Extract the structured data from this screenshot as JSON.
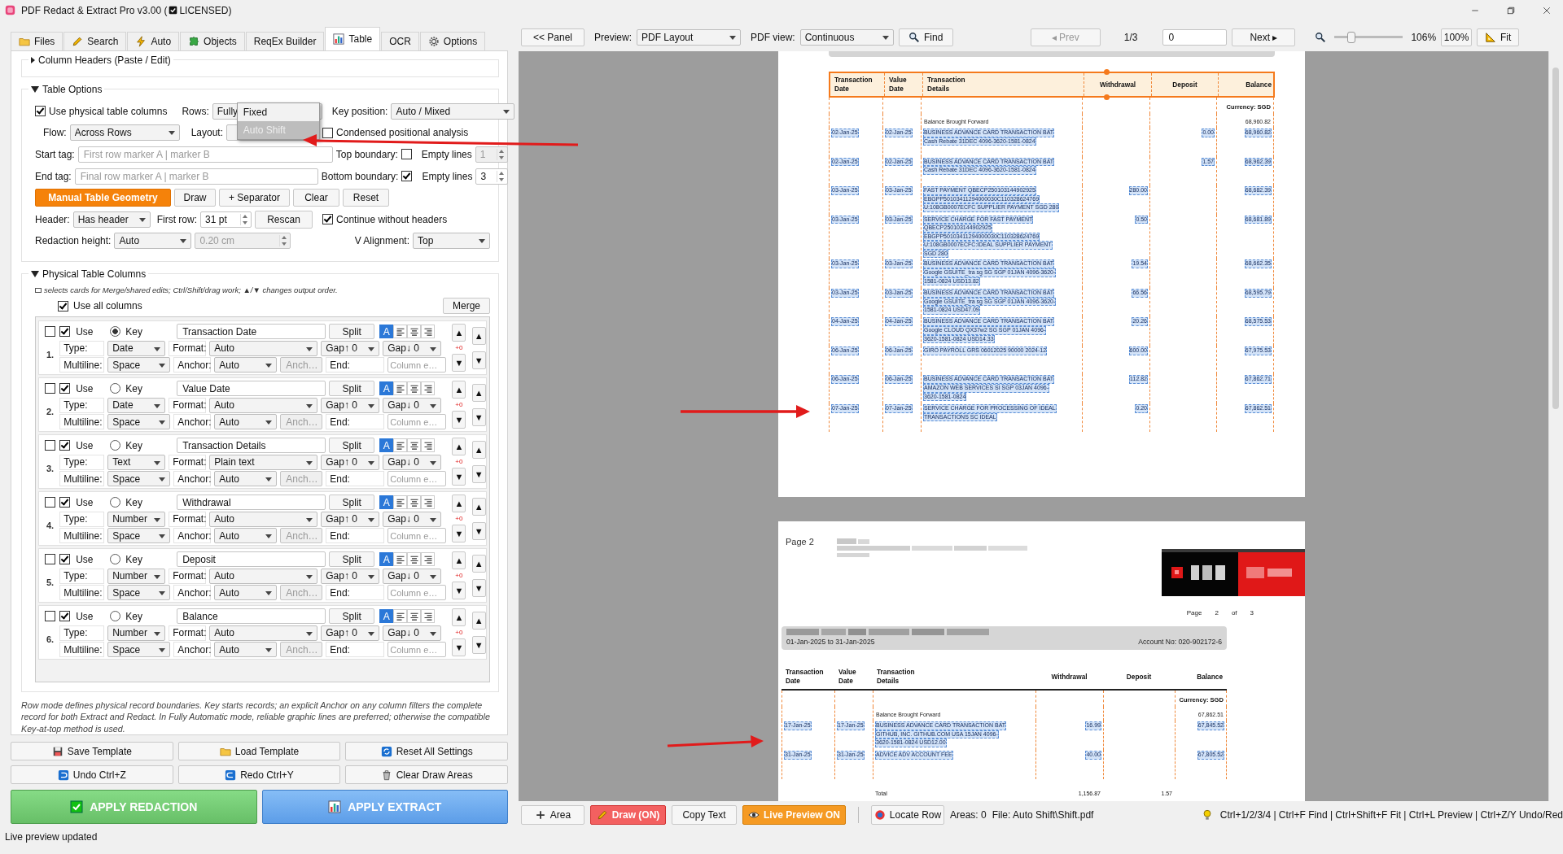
{
  "window": {
    "title_prefix": "PDF Redact & Extract Pro v3.00 (",
    "licensed": true,
    "title_suffix": "LICENSED)"
  },
  "tabs": [
    {
      "label": "Files",
      "selected": false
    },
    {
      "label": "Search",
      "selected": false
    },
    {
      "label": "Auto",
      "selected": false
    },
    {
      "label": "Objects",
      "selected": false
    },
    {
      "label": "ReqEx Builder",
      "selected": false
    },
    {
      "label": "Table",
      "selected": true
    },
    {
      "label": "OCR",
      "selected": false
    },
    {
      "label": "Options",
      "selected": false
    }
  ],
  "column_headers": {
    "title": "Column Headers (Paste / Edit)",
    "expanded": false
  },
  "table_options": {
    "title": "Table Options",
    "expanded": true,
    "use_physical": {
      "label": "Use physical table columns",
      "checked": true
    },
    "rows": {
      "label": "Rows:",
      "value": "Fully"
    },
    "rows_menu": [
      {
        "label": "Fixed",
        "selected": false
      },
      {
        "label": "Auto Shift",
        "selected": true
      }
    ],
    "key_position": {
      "label": "Key position:",
      "value": "Auto / Mixed"
    },
    "flow": {
      "label": "Flow:",
      "value": "Across Rows"
    },
    "layout": {
      "label": "Layout:"
    },
    "condensed": {
      "label": "Condensed positional analysis",
      "checked": false
    },
    "start_tag": {
      "label": "Start tag:",
      "placeholder": "First row marker A | marker B"
    },
    "top_boundary": {
      "label": "Top boundary:",
      "checked": false
    },
    "top_empty": {
      "label": "Empty lines",
      "value": "1",
      "disabled": true
    },
    "end_tag": {
      "label": "End tag:",
      "placeholder": "Final row marker A | marker B"
    },
    "bottom_boundary": {
      "label": "Bottom boundary:",
      "checked": true
    },
    "bottom_empty": {
      "label": "Empty lines",
      "value": "3",
      "disabled": false
    },
    "buttons": [
      {
        "label": "Manual Table Geometry",
        "kind": "primary"
      },
      {
        "label": "Draw",
        "kind": "plain"
      },
      {
        "label": "+ Separator",
        "kind": "plain"
      },
      {
        "label": "Clear",
        "kind": "plain"
      },
      {
        "label": "Reset",
        "kind": "plain"
      }
    ],
    "header": {
      "label": "Header:",
      "value": "Has header"
    },
    "first_row": {
      "label": "First row:",
      "value": "31 pt"
    },
    "rescan": "Rescan",
    "continue_without_headers": {
      "label": "Continue without headers",
      "checked": true
    },
    "redaction_height": {
      "label": "Redaction height:",
      "value": "Auto"
    },
    "height_value": {
      "value": "0.20 cm",
      "disabled": true
    },
    "v_alignment": {
      "label": "V Alignment:",
      "value": "Top"
    }
  },
  "physical_columns": {
    "title": "Physical Table Columns",
    "expanded": true,
    "hint": "selects cards for Merge/shared edits; Ctrl/Shift/drag work; ▲/▼ changes output order.",
    "use_all": {
      "label": "Use all columns",
      "checked": true
    },
    "merge": "Merge",
    "cards": [
      {
        "number": "1.",
        "selected": false,
        "use": {
          "label": "Use",
          "checked": true
        },
        "key": {
          "label": "Key",
          "selected": true
        },
        "name": "Transaction Date",
        "split": "Split",
        "align": [
          {
            "kind": "auto",
            "label": "A",
            "selected": true
          },
          {
            "kind": "left",
            "selected": false
          },
          {
            "kind": "center",
            "selected": false
          },
          {
            "kind": "right",
            "selected": false
          }
        ],
        "type": {
          "label": "Type:",
          "value": "Date"
        },
        "format": {
          "label": "Format:",
          "value": "Auto"
        },
        "gap_up": "Gap↑ 0",
        "gap_down": "Gap↓ 0",
        "offset": "+0",
        "multiline": {
          "label": "Multiline:",
          "value": "Space"
        },
        "anchor": {
          "label": "Anchor:",
          "value": "Auto"
        },
        "anchor_text": {
          "placeholder": "Anch…"
        },
        "end": {
          "label": "End:",
          "placeholder": "Column e…"
        },
        "move": [
          "▲",
          "▼"
        ],
        "order": [
          "▲",
          "▼"
        ]
      },
      {
        "number": "2.",
        "selected": false,
        "use": {
          "label": "Use",
          "checked": true
        },
        "key": {
          "label": "Key",
          "selected": false
        },
        "name": "Value Date",
        "split": "Split",
        "align": [
          {
            "kind": "auto",
            "label": "A",
            "selected": true
          },
          {
            "kind": "left",
            "selected": false
          },
          {
            "kind": "center",
            "selected": false
          },
          {
            "kind": "right",
            "selected": false
          }
        ],
        "type": {
          "label": "Type:",
          "value": "Date"
        },
        "format": {
          "label": "Format:",
          "value": "Auto"
        },
        "gap_up": "Gap↑ 0",
        "gap_down": "Gap↓ 0",
        "offset": "+0",
        "multiline": {
          "label": "Multiline:",
          "value": "Space"
        },
        "anchor": {
          "label": "Anchor:",
          "value": "Auto"
        },
        "anchor_text": {
          "placeholder": "Anch…"
        },
        "end": {
          "label": "End:",
          "placeholder": "Column e…"
        },
        "move": [
          "▲",
          "▼"
        ],
        "order": [
          "▲",
          "▼"
        ]
      },
      {
        "number": "3.",
        "selected": false,
        "use": {
          "label": "Use",
          "checked": true
        },
        "key": {
          "label": "Key",
          "selected": false
        },
        "name": "Transaction Details",
        "split": "Split",
        "align": [
          {
            "kind": "auto",
            "label": "A",
            "selected": true
          },
          {
            "kind": "left",
            "selected": false
          },
          {
            "kind": "center",
            "selected": false
          },
          {
            "kind": "right",
            "selected": false
          }
        ],
        "type": {
          "label": "Type:",
          "value": "Text"
        },
        "format": {
          "label": "Format:",
          "value": "Plain text"
        },
        "gap_up": "Gap↑ 0",
        "gap_down": "Gap↓ 0",
        "offset": "+0",
        "multiline": {
          "label": "Multiline:",
          "value": "Space"
        },
        "anchor": {
          "label": "Anchor:",
          "value": "Auto"
        },
        "anchor_text": {
          "placeholder": "Anch…"
        },
        "end": {
          "label": "End:",
          "placeholder": "Column e…"
        },
        "move": [
          "▲",
          "▼"
        ],
        "order": [
          "▲",
          "▼"
        ]
      },
      {
        "number": "4.",
        "selected": false,
        "use": {
          "label": "Use",
          "checked": true
        },
        "key": {
          "label": "Key",
          "selected": false
        },
        "name": "Withdrawal",
        "split": "Split",
        "align": [
          {
            "kind": "auto",
            "label": "A",
            "selected": true
          },
          {
            "kind": "left",
            "selected": false
          },
          {
            "kind": "center",
            "selected": false
          },
          {
            "kind": "right",
            "selected": false
          }
        ],
        "type": {
          "label": "Type:",
          "value": "Number"
        },
        "format": {
          "label": "Format:",
          "value": "Auto"
        },
        "gap_up": "Gap↑ 0",
        "gap_down": "Gap↓ 0",
        "offset": "+0",
        "multiline": {
          "label": "Multiline:",
          "value": "Space"
        },
        "anchor": {
          "label": "Anchor:",
          "value": "Auto"
        },
        "anchor_text": {
          "placeholder": "Anch…"
        },
        "end": {
          "label": "End:",
          "placeholder": "Column e…"
        },
        "move": [
          "▲",
          "▼"
        ],
        "order": [
          "▲",
          "▼"
        ]
      },
      {
        "number": "5.",
        "selected": false,
        "use": {
          "label": "Use",
          "checked": true
        },
        "key": {
          "label": "Key",
          "selected": false
        },
        "name": "Deposit",
        "split": "Split",
        "align": [
          {
            "kind": "auto",
            "label": "A",
            "selected": true
          },
          {
            "kind": "left",
            "selected": false
          },
          {
            "kind": "center",
            "selected": false
          },
          {
            "kind": "right",
            "selected": false
          }
        ],
        "type": {
          "label": "Type:",
          "value": "Number"
        },
        "format": {
          "label": "Format:",
          "value": "Auto"
        },
        "gap_up": "Gap↑ 0",
        "gap_down": "Gap↓ 0",
        "offset": "+0",
        "multiline": {
          "label": "Multiline:",
          "value": "Space"
        },
        "anchor": {
          "label": "Anchor:",
          "value": "Auto"
        },
        "anchor_text": {
          "placeholder": "Anch…"
        },
        "end": {
          "label": "End:",
          "placeholder": "Column e…"
        },
        "move": [
          "▲",
          "▼"
        ],
        "order": [
          "▲",
          "▼"
        ]
      },
      {
        "number": "6.",
        "selected": false,
        "use": {
          "label": "Use",
          "checked": true
        },
        "key": {
          "label": "Key",
          "selected": false
        },
        "name": "Balance",
        "split": "Split",
        "align": [
          {
            "kind": "auto",
            "label": "A",
            "selected": true
          },
          {
            "kind": "left",
            "selected": false
          },
          {
            "kind": "center",
            "selected": false
          },
          {
            "kind": "right",
            "selected": false
          }
        ],
        "type": {
          "label": "Type:",
          "value": "Number"
        },
        "format": {
          "label": "Format:",
          "value": "Auto"
        },
        "gap_up": "Gap↑ 0",
        "gap_down": "Gap↓ 0",
        "offset": "+0",
        "multiline": {
          "label": "Multiline:",
          "value": "Space"
        },
        "anchor": {
          "label": "Anchor:",
          "value": "Auto"
        },
        "anchor_text": {
          "placeholder": "Anch…"
        },
        "end": {
          "label": "End:",
          "placeholder": "Column e…"
        },
        "move": [
          "▲",
          "▼"
        ],
        "order": [
          "▲",
          "▼"
        ]
      }
    ]
  },
  "note": "Row mode defines physical record boundaries. Key starts records; an explicit Anchor on any column filters the complete record for both Extract and Redact. In Fully Automatic mode, reliable graphic lines are preferred; otherwise the compatible Key-at-top method is used.",
  "actions": [
    {
      "label": "Save Template"
    },
    {
      "label": "Load Template"
    },
    {
      "label": "Reset All Settings"
    },
    {
      "label": "Undo  Ctrl+Z"
    },
    {
      "label": "Redo  Ctrl+Y"
    },
    {
      "label": "Clear Draw Areas"
    }
  ],
  "apply": [
    {
      "label": "APPLY REDACTION",
      "kind": "redact"
    },
    {
      "label": "APPLY EXTRACT",
      "kind": "extract"
    }
  ],
  "status": "Live preview updated",
  "toolbar": {
    "panel": "<< Panel",
    "preview": {
      "label": "Preview:",
      "value": "PDF Layout"
    },
    "pdf_view": {
      "label": "PDF view:",
      "value": "Continuous"
    },
    "find": "Find",
    "prev": {
      "label": "◂ Prev",
      "disabled": true
    },
    "page_count": "1/3",
    "page_input": "0",
    "next": {
      "label": "Next ▸",
      "disabled": false
    },
    "zoom": {
      "level": 0.25,
      "reading": "106%"
    },
    "reset_zoom": "100%",
    "fit": "Fit"
  },
  "pages": [
    {
      "kind": "first",
      "table": {
        "header_selected": true,
        "columns": [
          "Transaction Date",
          "Value Date",
          "Transaction Details",
          "Withdrawal",
          "Deposit",
          "Balance"
        ],
        "rows": [
          {
            "kind": "currency",
            "balance": "Currency: SGD"
          },
          {
            "kind": "plain",
            "details": [
              "Balance Brought Forward"
            ],
            "balance": "68,960.82"
          },
          {
            "kind": "entry",
            "highlighted": true,
            "date": "02-Jan-25",
            "value_date": "02-Jan-25",
            "details": [
              "BUSINESS ADVANCE CARD TRANSACTION BAT",
              "Cash Rebate 31DEC 4096-3620-1581-0824"
            ],
            "deposit": "0.00",
            "balance": "68,960.82"
          },
          {
            "kind": "entry",
            "highlighted": true,
            "date": "02-Jan-25",
            "value_date": "02-Jan-25",
            "details": [
              "BUSINESS ADVANCE CARD TRANSACTION BAT",
              "Cash Rebate 31DEC 4096-3620-1581-0824"
            ],
            "deposit": "1.57",
            "balance": "68,962.39"
          },
          {
            "kind": "entry",
            "highlighted": true,
            "date": "03-Jan-25",
            "value_date": "03-Jan-25",
            "details": [
              "FAST PAYMENT QBECP250103144902925",
              "EBGPP50103411294000030C110328624769",
              "U:108GB0007ECFC SUPPLIER PAYMENT SGD 280"
            ],
            "withdrawal": "280.00",
            "balance": "68,682.39"
          },
          {
            "kind": "entry",
            "highlighted": true,
            "date": "03-Jan-25",
            "value_date": "03-Jan-25",
            "details": [
              "SERVICE CHARGE FOR FAST PAYMENT",
              "QBECP250103144902925",
              "EBGPP50103411294000030C110328624769",
              "U:108GB0007ECFC:IDEAL SUPPLIER PAYMENT",
              "SGD 280"
            ],
            "withdrawal": "0.50",
            "balance": "68,681.89"
          },
          {
            "kind": "entry",
            "highlighted": true,
            "date": "03-Jan-25",
            "value_date": "03-Jan-25",
            "details": [
              "BUSINESS ADVANCE CARD TRANSACTION BAT",
              "Google GSUITE_tra sg SG SGP 01JAN 4096-3620-",
              "1581-0824 USD13.82"
            ],
            "withdrawal": "19.54",
            "balance": "68,662.35"
          },
          {
            "kind": "entry",
            "highlighted": true,
            "date": "03-Jan-25",
            "value_date": "03-Jan-25",
            "details": [
              "BUSINESS ADVANCE CARD TRANSACTION BAT",
              "Google GSUITE_tra sg SG SGP 01JAN 4096-3620-",
              "1581-0824 USD47.09"
            ],
            "withdrawal": "66.56",
            "balance": "68,595.79"
          },
          {
            "kind": "entry",
            "highlighted": true,
            "date": "04-Jan-25",
            "value_date": "04-Jan-25",
            "details": [
              "BUSINESS ADVANCE CARD TRANSACTION BAT",
              "Google CLOUD QX37w2 SG SGP 01JAN 4096-",
              "3620-1581-0824 USD14.33"
            ],
            "withdrawal": "20.26",
            "balance": "68,575.53"
          },
          {
            "kind": "entry",
            "highlighted": true,
            "date": "06-Jan-25",
            "value_date": "06-Jan-25",
            "details": [
              "GIRO PAYROLL GRS 06012025 90000 2024-12"
            ],
            "withdrawal": "600.00",
            "balance": "67,975.53"
          },
          {
            "kind": "entry",
            "highlighted": true,
            "date": "06-Jan-25",
            "value_date": "06-Jan-25",
            "details": [
              "BUSINESS ADVANCE CARD TRANSACTION BAT",
              "AMAZON WEB SERVICES SI SGP 03JAN 4096-",
              "3620-1581-0824"
            ],
            "withdrawal": "112.82",
            "balance": "67,862.71"
          },
          {
            "kind": "entry",
            "highlighted": true,
            "date": "07-Jan-25",
            "value_date": "07-Jan-25",
            "details": [
              "SERVICE CHARGE FOR PROCESSING OF IDEAL",
              "TRANSACTIONS SC IDEAL"
            ],
            "withdrawal": "0.20",
            "balance": "67,862.51"
          }
        ]
      }
    },
    {
      "kind": "continued",
      "label": "Page 2",
      "page_of": [
        "Page",
        "2",
        "of",
        "3"
      ],
      "period": "01-Jan-2025  to  31-Jan-2025",
      "account": "Account No: 020-902172-6",
      "table": {
        "header_selected": false,
        "columns": [
          "Transaction Date",
          "Value Date",
          "Transaction Details",
          "Withdrawal",
          "Deposit",
          "Balance"
        ],
        "rows": [
          {
            "kind": "currency",
            "balance": "Currency: SGD"
          },
          {
            "kind": "plain",
            "details": [
              "Balance Brought Forward"
            ],
            "balance": "67,862.51"
          },
          {
            "kind": "entry",
            "highlighted": true,
            "date": "17-Jan-25",
            "value_date": "17-Jan-25",
            "details": [
              "BUSINESS ADVANCE CARD TRANSACTION BAT",
              "GITHUB, INC. GITHUB.COM USA 15JAN 4096-",
              "3620-1581-0824 USD12.00"
            ],
            "withdrawal": "16.99",
            "balance": "67,845.52"
          },
          {
            "kind": "entry",
            "highlighted": true,
            "date": "31-Jan-25",
            "value_date": "31-Jan-25",
            "details": [
              "ADVICE ADV ACCOUNT FEE"
            ],
            "withdrawal": "40.00",
            "balance": "67,805.52"
          }
        ]
      },
      "total": {
        "label": "Total",
        "withdrawal": "1,156.87",
        "deposit": "1.57"
      }
    }
  ],
  "bottom_bar": {
    "area": "Area",
    "draw": {
      "label": "Draw (ON)",
      "on": true
    },
    "copy_text": "Copy Text",
    "live_preview": {
      "label": "Live Preview ON",
      "on": true
    },
    "locate_row": "Locate Row",
    "areas": "Areas: 0",
    "file": "File: Auto Shift\\Shift.pdf",
    "shortcuts": "Ctrl+1/2/3/4 | Ctrl+F Find | Ctrl+Shift+F Fit | Ctrl+L Preview | Ctrl+Z/Y Undo/Red"
  }
}
